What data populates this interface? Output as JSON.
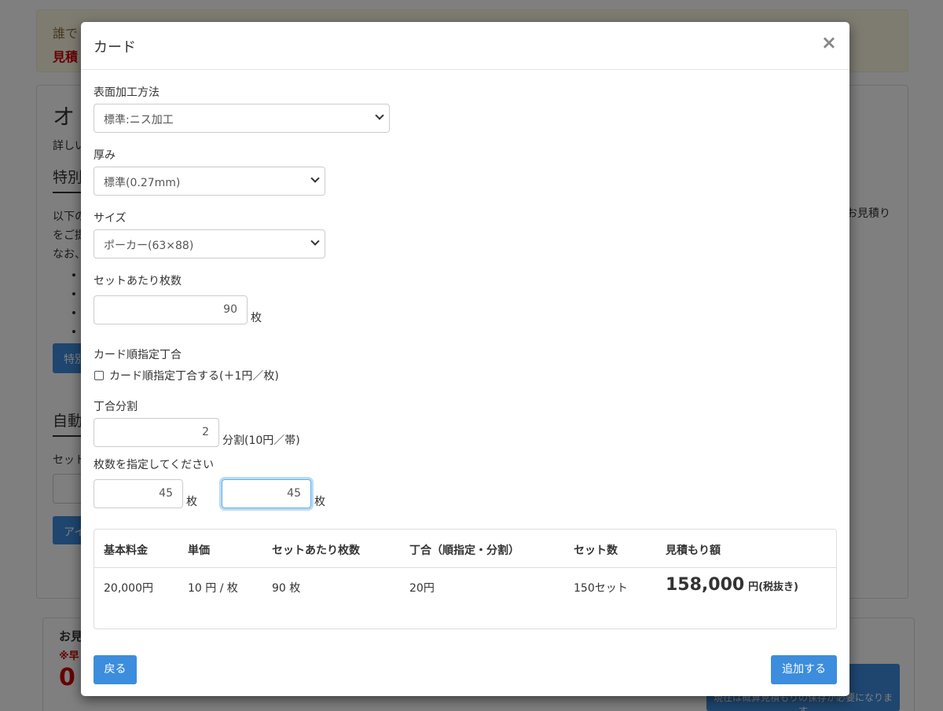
{
  "background": {
    "alert_line1": "誰で",
    "alert_line2": "見積",
    "panel_title": "オ",
    "panel_subtitle": "詳しい",
    "section1_heading": "特別",
    "para_line1": "以下の",
    "para_line2": "をご提",
    "para_line3": "なお、",
    "para_right": "お見積り",
    "button1_label": "特別",
    "section2_heading": "自動",
    "label2": "セット",
    "button2_label": "アイ",
    "box2_title": "お見",
    "box2_note": "※早",
    "box2_value": "0",
    "big_button_label": "現在は概算見積もりの保存が必要になります"
  },
  "modal": {
    "title": "カード",
    "close_label": "×",
    "surface": {
      "label": "表面加工方法",
      "selected": "標準:ニス加工"
    },
    "thickness": {
      "label": "厚み",
      "selected": "標準(0.27mm)"
    },
    "size": {
      "label": "サイズ",
      "selected": "ポーカー(63×88)"
    },
    "per_set": {
      "label": "セットあたり枚数",
      "value": "90",
      "unit": "枚"
    },
    "order": {
      "label": "カード順指定丁合",
      "checkbox_label": "カード順指定丁合する(＋1円／枚)",
      "checked": false
    },
    "split": {
      "label": "丁合分割",
      "value": "2",
      "unit": "分割(10円／帯)"
    },
    "counts": {
      "label": "枚数を指定してください",
      "value1": "45",
      "unit1": "枚",
      "value2": "45",
      "unit2": "枚"
    },
    "table": {
      "headers": [
        "基本料金",
        "単価",
        "セットあたり枚数",
        "丁合（順指定・分割）",
        "セット数",
        "見積もり額"
      ],
      "row": [
        "20,000円",
        "10 円 / 枚",
        "90 枚",
        "20円",
        "150セット"
      ],
      "total_amount": "158,000",
      "total_suffix": "円(税抜き)"
    },
    "back_label": "戻る",
    "add_label": "追加する"
  },
  "colors": {
    "accent": "#3c8dde",
    "price": "#dd0000"
  }
}
